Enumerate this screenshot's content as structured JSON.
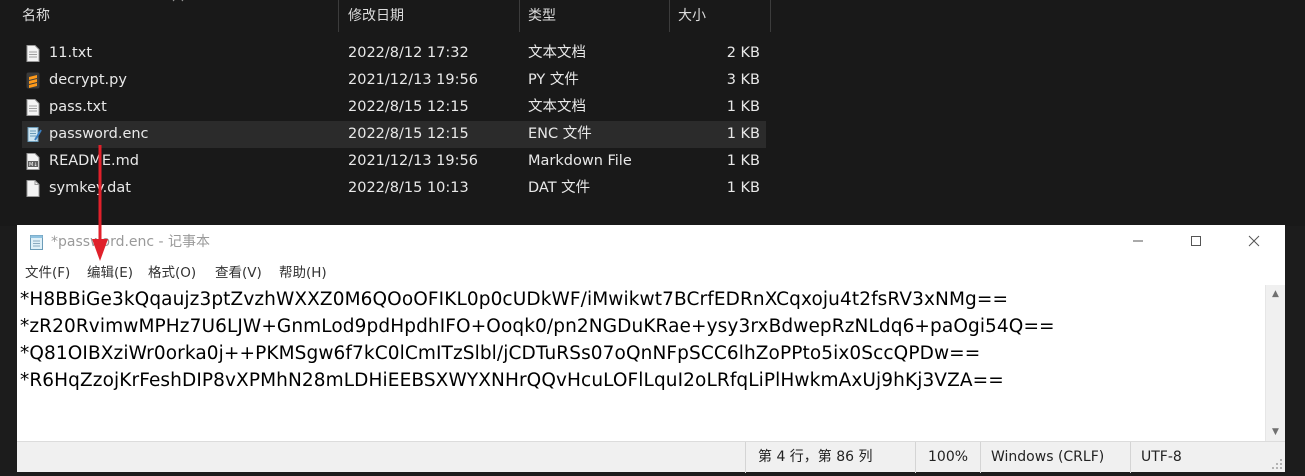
{
  "explorer": {
    "columns": {
      "name": "名称",
      "modified": "修改日期",
      "type": "类型",
      "size": "大小"
    },
    "files": [
      {
        "name": "11.txt",
        "modified": "2022/8/12 17:32",
        "type": "文本文档",
        "size": "2 KB",
        "icon": "text-file-icon",
        "selected": false
      },
      {
        "name": "decrypt.py",
        "modified": "2021/12/13 19:56",
        "type": "PY 文件",
        "size": "3 KB",
        "icon": "sublime-python-file-icon",
        "selected": false
      },
      {
        "name": "pass.txt",
        "modified": "2022/8/15 12:15",
        "type": "文本文档",
        "size": "1 KB",
        "icon": "text-file-icon",
        "selected": false
      },
      {
        "name": "password.enc",
        "modified": "2022/8/15 12:15",
        "type": "ENC 文件",
        "size": "1 KB",
        "icon": "notepad-file-icon",
        "selected": true
      },
      {
        "name": "README.md",
        "modified": "2021/12/13 19:56",
        "type": "Markdown File",
        "size": "1 KB",
        "icon": "markdown-file-icon",
        "selected": false
      },
      {
        "name": "symkey.dat",
        "modified": "2022/8/15 10:13",
        "type": "DAT 文件",
        "size": "1 KB",
        "icon": "blank-file-icon",
        "selected": false
      }
    ]
  },
  "notepad": {
    "title": "*password.enc - 记事本",
    "menu": [
      "文件(F)",
      "编辑(E)",
      "格式(O)",
      "查看(V)",
      "帮助(H)"
    ],
    "lines": [
      "*H8BBiGe3kQqaujz3ptZvzhWXXZ0M6QOoOFIKL0p0cUDkWF/iMwikwt7BCrfEDRnXCqxoju4t2fsRV3xNMg==",
      "*zR20RvimwMPHz7U6LJW+GnmLod9pdHpdhIFO+Ooqk0/pn2NGDuKRae+ysy3rxBdwepRzNLdq6+paOgi54Q==",
      "*Q81OIBXziWr0orka0j++PKMSgw6f7kC0lCmITzSlbl/jCDTuRSs07oQnNFpSCC6lhZoPPto5ix0SccQPDw==",
      "*R6HqZzojKrFeshDIP8vXPMhN28mLDHiEEBSXWYXNHrQQvHcuLOFlLquI2oLRfqLiPlHwkmAxUj9hKj3VZA=="
    ],
    "status": {
      "position": "第 4 行，第 86 列",
      "zoom": "100%",
      "line_ending": "Windows (CRLF)",
      "encoding": "UTF-8"
    }
  },
  "colors": {
    "explorer_bg": "#191919",
    "selected_row": "#2b2b2b",
    "annotation_arrow": "#e0202a"
  }
}
